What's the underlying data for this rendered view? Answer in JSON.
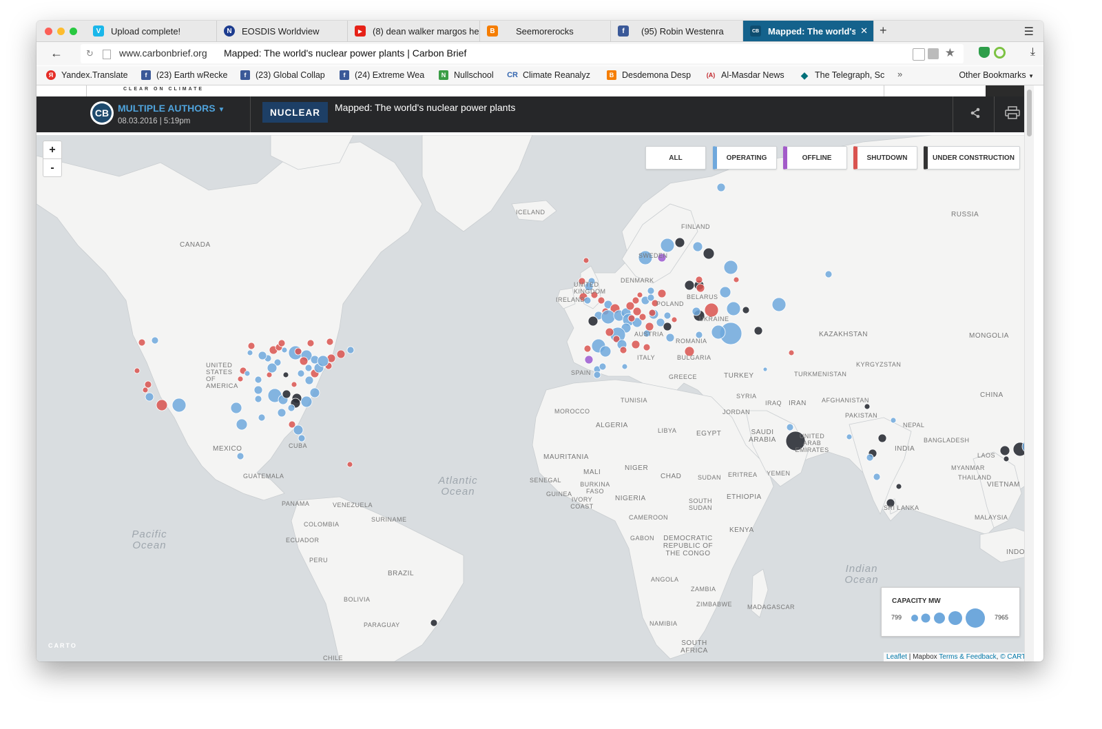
{
  "browser": {
    "tabs": [
      {
        "label": "Upload complete!",
        "icon": "vimeo-icon",
        "color": "#1ab7ea",
        "glyph": "V"
      },
      {
        "label": "EOSDIS Worldview",
        "icon": "nasa-icon",
        "color": "#1d3c8f",
        "glyph": "N"
      },
      {
        "label": "(8) dean walker margos he",
        "icon": "youtube-icon",
        "color": "#e62117",
        "glyph": "▶"
      },
      {
        "label": "Seemorerocks",
        "icon": "blogger-icon",
        "color": "#f57d00",
        "glyph": "B"
      },
      {
        "label": "(95) Robin Westenra",
        "icon": "facebook-icon",
        "color": "#3b5998",
        "glyph": "f"
      },
      {
        "label": "Mapped: The world's nu",
        "icon": "carbonbrief-icon",
        "color": "#14628c",
        "glyph": "CB"
      }
    ],
    "url_host": "www.carbonbrief.org",
    "url_title": "Mapped: The world's nuclear power plants | Carbon Brief",
    "bookmarks": [
      {
        "label": "Yandex.Translate",
        "color": "#e52d27",
        "glyph": "Я"
      },
      {
        "label": "(23) Earth wRecke",
        "color": "#3b5998",
        "glyph": "f"
      },
      {
        "label": "(23) Global Collap",
        "color": "#3b5998",
        "glyph": "f"
      },
      {
        "label": "(24) Extreme Wea",
        "color": "#3b5998",
        "glyph": "f"
      },
      {
        "label": "Nullschool",
        "color": "#3a9d45",
        "glyph": "N"
      },
      {
        "label": "Climate Reanalyz",
        "color": "#3567b0",
        "glyph": "CR"
      },
      {
        "label": "Desdemona Desp",
        "color": "#f57d00",
        "glyph": "B"
      },
      {
        "label": "Al-Masdar News",
        "color": "#c2272d",
        "glyph": "A"
      },
      {
        "label": "The Telegraph, Sc",
        "color": "#00707a",
        "glyph": "◆"
      }
    ],
    "other_bookmarks": "Other Bookmarks"
  },
  "site": {
    "tagline": "CLEAR ON CLIMATE",
    "logo": "CB",
    "authors": "MULTIPLE AUTHORS",
    "date": "08.03.2016 | 5:19pm",
    "category": "NUCLEAR",
    "title": "Mapped: The world's nuclear power plants"
  },
  "map": {
    "zoom_in": "+",
    "zoom_out": "-",
    "filters": [
      {
        "label": "ALL",
        "color": "#ffffff"
      },
      {
        "label": "OPERATING",
        "color": "#6fa8dc"
      },
      {
        "label": "OFFLINE",
        "color": "#a35bc9"
      },
      {
        "label": "SHUTDOWN",
        "color": "#d9534f"
      },
      {
        "label": "UNDER CONSTRUCTION",
        "color": "#333333"
      }
    ],
    "status_colors": {
      "operating": "#6fa8dc",
      "offline": "#9b59d0",
      "shutdown": "#d9534f",
      "construction": "#2b2f36"
    },
    "labels": [
      "CANADA",
      "UNITED STATES OF AMERICA",
      "MEXICO",
      "CUBA",
      "GUATEMALA",
      "PANAMA",
      "VENEZUELA",
      "COLOMBIA",
      "SURINAME",
      "ECUADOR",
      "PERU",
      "BRAZIL",
      "BOLIVIA",
      "PARAGUAY",
      "CHILE",
      "ICELAND",
      "FINLAND",
      "SWEDEN",
      "DENMARK",
      "UNITED KINGDOM",
      "IRELAND",
      "POLAND",
      "BELARUS",
      "UKRAINE",
      "AUSTRIA",
      "ROMANIA",
      "BULGARIA",
      "ITALY",
      "SPAIN",
      "GREECE",
      "TURKEY",
      "RUSSIA",
      "KAZAKHSTAN",
      "MONGOLIA",
      "KYRGYZSTAN",
      "TURKMENISTAN",
      "CHINA",
      "AFGHANISTAN",
      "PAKISTAN",
      "NEPAL",
      "INDIA",
      "BANGLADESH",
      "IRAN",
      "IRAQ",
      "SYRIA",
      "JORDAN",
      "SAUDI ARABIA",
      "UNITED ARAB EMIRATES",
      "YEMEN",
      "ERITREA",
      "ETHIOPIA",
      "SUDAN",
      "SOUTH SUDAN",
      "KENYA",
      "EGYPT",
      "LIBYA",
      "TUNISIA",
      "MOROCCO",
      "ALGERIA",
      "MAURITANIA",
      "MALI",
      "NIGER",
      "CHAD",
      "SENEGAL",
      "GUINEA",
      "BURKINA FASO",
      "IVORY COAST",
      "NIGERIA",
      "CAMEROON",
      "GABON",
      "DEMOCRATIC REPUBLIC OF THE CONGO",
      "ANGOLA",
      "ZAMBIA",
      "ZIMBABWE",
      "NAMIBIA",
      "SOUTH AFRICA",
      "MADAGASCAR",
      "LAOS",
      "MYANMAR",
      "THAILAND",
      "VIETNAM",
      "MALAYSIA",
      "SRI LANKA",
      "INDON"
    ],
    "oceans": [
      "Atlantic Ocean",
      "Pacific Ocean",
      "Indian Ocean"
    ],
    "legend": {
      "title": "CAPACITY MW",
      "min": "799",
      "max": "7965"
    },
    "attribution": {
      "leaflet": "Leaflet",
      "mapbox": "Mapbox",
      "terms": "Terms & Feedback",
      "carto": "© CARTO"
    },
    "carto_logo": "CARTO"
  }
}
